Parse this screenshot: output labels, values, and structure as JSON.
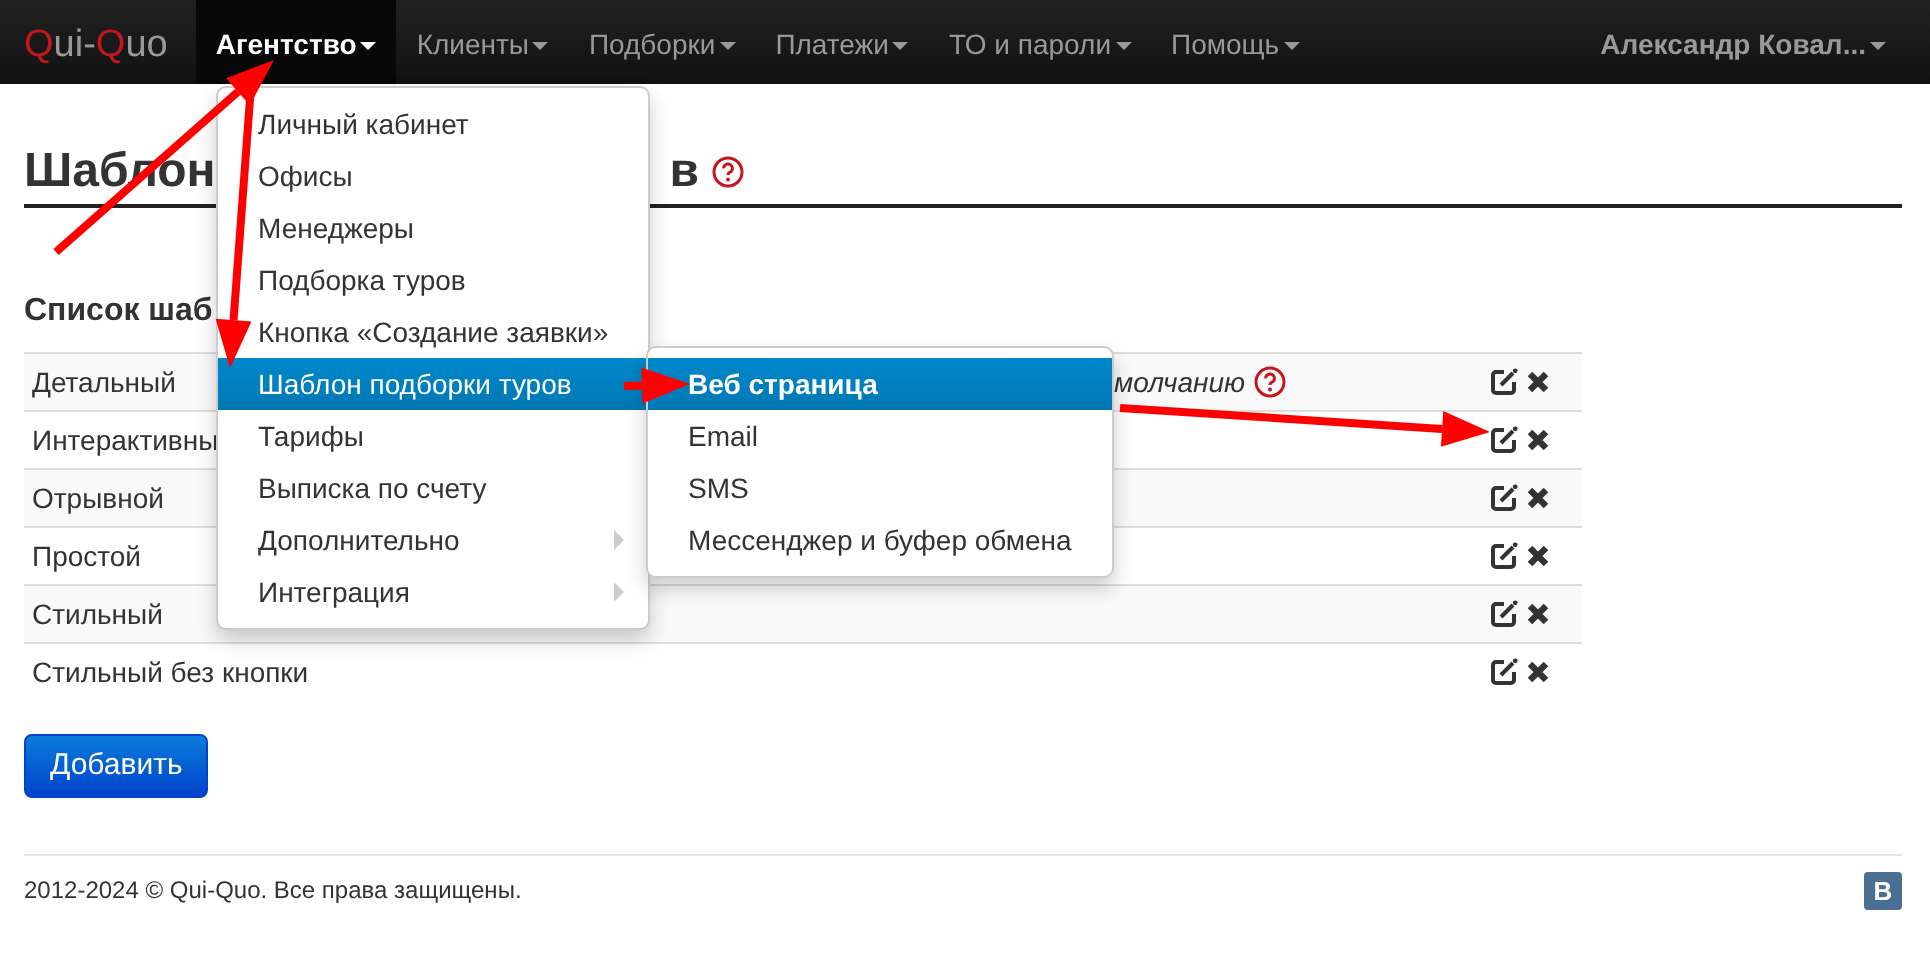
{
  "navbar": {
    "brand": [
      {
        "text": "Q",
        "accent": true
      },
      {
        "text": "ui-",
        "accent": false
      },
      {
        "text": "Q",
        "accent": true
      },
      {
        "text": "uo",
        "accent": false
      }
    ],
    "items": [
      {
        "label": "Агентство",
        "selected": true
      },
      {
        "label": "Клиенты",
        "selected": false
      },
      {
        "label": "Подборки",
        "selected": false
      },
      {
        "label": "Платежи",
        "selected": false
      },
      {
        "label": "ТО и пароли",
        "selected": false
      },
      {
        "label": "Помощь",
        "selected": false
      }
    ],
    "user": "Александр Ковал..."
  },
  "dropdown": {
    "items": [
      {
        "label": "Личный кабинет",
        "selected": false,
        "submenu": false
      },
      {
        "label": "Офисы",
        "selected": false,
        "submenu": false
      },
      {
        "label": "Менеджеры",
        "selected": false,
        "submenu": false
      },
      {
        "label": "Подборка туров",
        "selected": false,
        "submenu": false
      },
      {
        "label": "Кнопка «Создание заявки»",
        "selected": false,
        "submenu": false
      },
      {
        "label": "Шаблон подборки туров",
        "selected": true,
        "submenu": false
      },
      {
        "label": "Тарифы",
        "selected": false,
        "submenu": false
      },
      {
        "label": "Выписка по счету",
        "selected": false,
        "submenu": false
      },
      {
        "label": "Дополнительно",
        "selected": false,
        "submenu": true
      },
      {
        "label": "Интеграция",
        "selected": false,
        "submenu": true
      }
    ]
  },
  "submenu": {
    "items": [
      {
        "label": "Веб страница",
        "selected": true
      },
      {
        "label": "Email",
        "selected": false
      },
      {
        "label": "SMS",
        "selected": false
      },
      {
        "label": "Мессенджер и буфер обмена",
        "selected": false
      }
    ]
  },
  "page": {
    "title_start": "Шаблон",
    "title_end": "в",
    "section": "Список шаб"
  },
  "table": {
    "rows": [
      {
        "name": "Детальный",
        "note": "молчанию",
        "help": true
      },
      {
        "name": "Интерактивны",
        "help": false
      },
      {
        "name": "Отрывной",
        "help": false
      },
      {
        "name": "Простой",
        "help": false
      },
      {
        "name": "Стильный",
        "help": false
      },
      {
        "name": "Стильный без кнопки",
        "help": false
      }
    ]
  },
  "add_button": "Добавить",
  "footer": {
    "text": "2012-2024 © Qui-Quo. Все права защищены.",
    "social": "B"
  }
}
